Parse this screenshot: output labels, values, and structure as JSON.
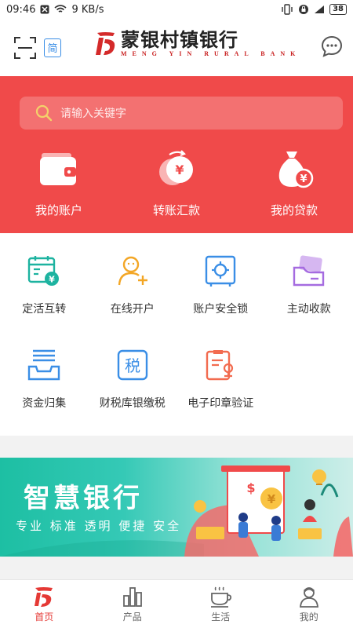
{
  "status": {
    "time": "09:46",
    "speed": "9 KB/s",
    "battery": "38"
  },
  "header": {
    "lang": "简",
    "logo_cn": "蒙银村镇银行",
    "logo_en": "MENG YIN RURAL BANK"
  },
  "search": {
    "placeholder": "请输入关键字"
  },
  "hero": [
    {
      "label": "我的账户",
      "icon": "wallet-icon"
    },
    {
      "label": "转账汇款",
      "icon": "transfer-icon"
    },
    {
      "label": "我的贷款",
      "icon": "loan-bag-icon"
    }
  ],
  "services": [
    {
      "label": "定活互转",
      "icon": "calendar-money-icon"
    },
    {
      "label": "在线开户",
      "icon": "user-add-icon"
    },
    {
      "label": "账户安全锁",
      "icon": "safe-lock-icon"
    },
    {
      "label": "主动收款",
      "icon": "card-collect-icon"
    },
    {
      "label": "资金归集",
      "icon": "inbox-tray-icon"
    },
    {
      "label": "财税库银缴税",
      "icon": "tax-icon"
    },
    {
      "label": "电子印章验证",
      "icon": "seal-document-icon"
    }
  ],
  "banner": {
    "title": "智慧银行",
    "subtitle": "专业 标准 透明 便捷 安全"
  },
  "nav": [
    {
      "label": "首页",
      "icon": "home-logo-icon",
      "active": true
    },
    {
      "label": "产品",
      "icon": "bar-chart-icon",
      "active": false
    },
    {
      "label": "生活",
      "icon": "coffee-cup-icon",
      "active": false
    },
    {
      "label": "我的",
      "icon": "person-icon",
      "active": false
    }
  ],
  "colors": {
    "brand_red": "#f04a4a",
    "accent_blue": "#3a8ee6",
    "banner_teal": "#1dbfa3"
  }
}
